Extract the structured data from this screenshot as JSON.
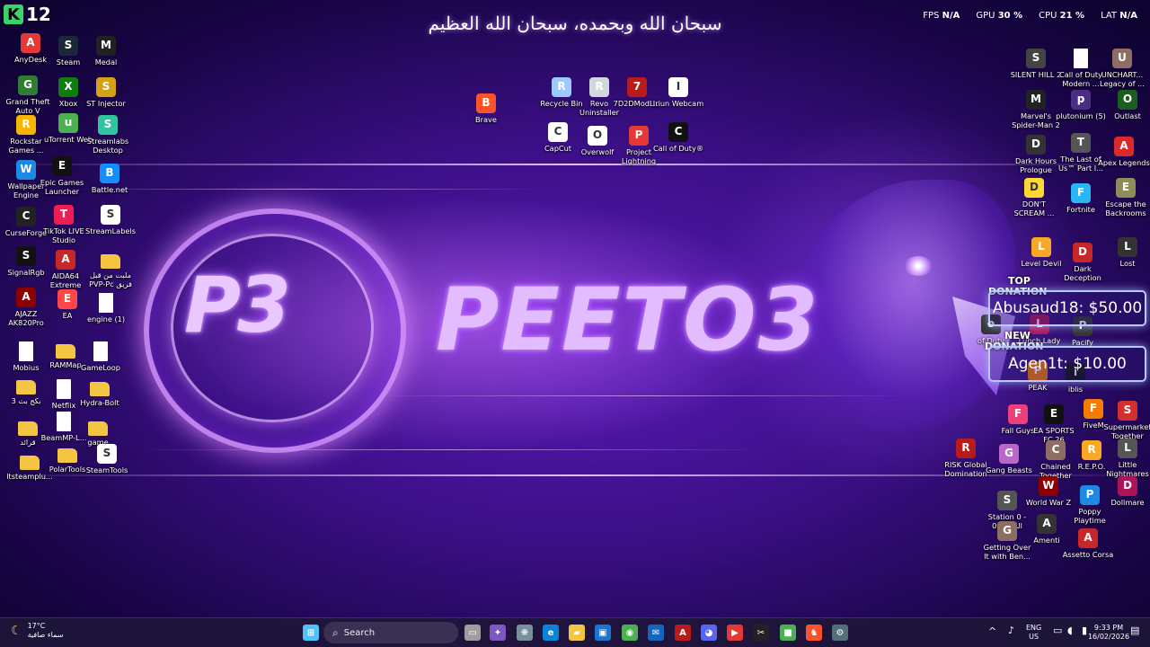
{
  "header": {
    "top_title": "سبحان الله وبحمده، سبحان الله العظيم",
    "k12_badge": "K",
    "k12_label": "12"
  },
  "perf": {
    "fps_label": "FPS",
    "fps_value": "N/A",
    "gpu_label": "GPU",
    "gpu_value": "30 %",
    "cpu_label": "CPU",
    "cpu_value": "21 %",
    "lat_label": "LAT",
    "lat_value": "N/A"
  },
  "wallpaper": {
    "logo_text": "P3",
    "brand_name": "PEETO3"
  },
  "donations": {
    "top_tag_1": "TOP",
    "top_tag_2": "DONATION",
    "top_text": "Abusaud18: $50.00",
    "new_tag_1": "NEW",
    "new_tag_2": "DONATION",
    "new_text": "Agen1t: $10.00"
  },
  "desktop_icons": [
    {
      "label": "AnyDesk",
      "icon": "anydesk-icon",
      "color": "#e53935"
    },
    {
      "label": "Steam",
      "icon": "steam-icon",
      "color": "#1b2838"
    },
    {
      "label": "Medal",
      "icon": "medal-icon",
      "color": "#222222"
    },
    {
      "label": "Grand Theft Auto V",
      "icon": "gta-icon",
      "color": "#2e7d32"
    },
    {
      "label": "Xbox",
      "icon": "xbox-icon",
      "color": "#107c10"
    },
    {
      "label": "ST Injector",
      "icon": "injector-icon",
      "color": "#d4a017"
    },
    {
      "label": "Rockstar Games ...",
      "icon": "rockstar-icon",
      "color": "#f7b500"
    },
    {
      "label": "uTorrent Web",
      "icon": "utorrent-icon",
      "color": "#4caf50"
    },
    {
      "label": "Streamlabs Desktop",
      "icon": "streamlabs-icon",
      "color": "#31c3a2"
    },
    {
      "label": "Wallpaper Engine",
      "icon": "wallpaper-engine-icon",
      "color": "#1e88e5"
    },
    {
      "label": "Epic Games Launcher",
      "icon": "epic-games-icon",
      "color": "#111111"
    },
    {
      "label": "Battle.net",
      "icon": "battlenet-icon",
      "color": "#148eff"
    },
    {
      "label": "CurseForge",
      "icon": "curseforge-icon",
      "color": "#222222"
    },
    {
      "label": "TikTok LIVE Studio",
      "icon": "tiktok-icon",
      "color": "#ee1d52"
    },
    {
      "label": "StreamLabels",
      "icon": "streamlabels-icon",
      "color": "#ffffff"
    },
    {
      "label": "SignalRgb",
      "icon": "signalrgb-icon",
      "color": "#111111"
    },
    {
      "label": "AIDA64 Extreme",
      "icon": "aida64-icon",
      "color": "#c62828"
    },
    {
      "label": "ملبت من قبل PVP-Pc فريق",
      "icon": "folder-icon",
      "color": "#f4c542"
    },
    {
      "label": "AJAZZ AK820Pro",
      "icon": "ajazz-icon",
      "color": "#8b0000"
    },
    {
      "label": "EA",
      "icon": "ea-icon",
      "color": "#ff4747"
    },
    {
      "label": "engine (1)",
      "icon": "file-icon",
      "color": "#ffffff"
    },
    {
      "label": "Mobius",
      "icon": "file-icon",
      "color": "#ffffff"
    },
    {
      "label": "RAMMap",
      "icon": "folder-icon",
      "color": "#f4c542"
    },
    {
      "label": "GameLoop",
      "icon": "file-icon",
      "color": "#ffffff"
    },
    {
      "label": "بكج بث 3",
      "icon": "folder-icon",
      "color": "#f4c542"
    },
    {
      "label": "Netflix",
      "icon": "file-icon",
      "color": "#ffffff"
    },
    {
      "label": "Hydra-Bolt",
      "icon": "folder-icon",
      "color": "#f4c542"
    },
    {
      "label": "قرائد",
      "icon": "folder-icon",
      "color": "#f4c542"
    },
    {
      "label": "BeamMP-L...",
      "icon": "file-icon",
      "color": "#ffffff"
    },
    {
      "label": "game",
      "icon": "folder-icon",
      "color": "#f4c542"
    },
    {
      "label": "ltsteamplu...",
      "icon": "folder-icon",
      "color": "#f4c542"
    },
    {
      "label": "PolarTools",
      "icon": "folder-icon",
      "color": "#f4c542"
    },
    {
      "label": "SteamTools",
      "icon": "steamtools-icon",
      "color": "#ffffff"
    },
    {
      "label": "Brave",
      "icon": "brave-icon",
      "color": "#fb542b"
    },
    {
      "label": "Recycle Bin",
      "icon": "recycle-bin-icon",
      "color": "#9ec9ff"
    },
    {
      "label": "Revo Uninstaller",
      "icon": "revo-icon",
      "color": "#cfd8dc"
    },
    {
      "label": "7D2DModL...",
      "icon": "mod-icon",
      "color": "#b71c1c"
    },
    {
      "label": "Iriun Webcam",
      "icon": "webcam-icon",
      "color": "#ffffff"
    },
    {
      "label": "CapCut",
      "icon": "capcut-icon",
      "color": "#ffffff"
    },
    {
      "label": "Overwolf",
      "icon": "overwolf-icon",
      "color": "#ffffff"
    },
    {
      "label": "Project Lightning",
      "icon": "lightning-icon",
      "color": "#e53935"
    },
    {
      "label": "Call of Duty®",
      "icon": "cod-icon",
      "color": "#111111"
    },
    {
      "label": "SILENT HILL 2",
      "icon": "silent-hill-icon",
      "color": "#444444"
    },
    {
      "label": "Call of Duty Modern ...",
      "icon": "file-icon",
      "color": "#ffffff"
    },
    {
      "label": "UNCHART... Legacy of ...",
      "icon": "uncharted-icon",
      "color": "#8d6e63"
    },
    {
      "label": "Marvel's Spider-Man 2",
      "icon": "spiderman-icon",
      "color": "#222222"
    },
    {
      "label": "plutonium (5)",
      "icon": "plutonium-icon",
      "color": "#4b2e83"
    },
    {
      "label": "Outlast",
      "icon": "outlast-icon",
      "color": "#1b5e20"
    },
    {
      "label": "Dark Hours Prologue",
      "icon": "dark-hours-icon",
      "color": "#333333"
    },
    {
      "label": "The Last of Us™ Part I...",
      "icon": "tlou-icon",
      "color": "#555555"
    },
    {
      "label": "Apex Legends",
      "icon": "apex-icon",
      "color": "#da292a"
    },
    {
      "label": "DON'T SCREAM ...",
      "icon": "dont-scream-icon",
      "color": "#fdd835"
    },
    {
      "label": "Fortnite",
      "icon": "fortnite-icon",
      "color": "#29b6f6"
    },
    {
      "label": "Escape the Backrooms",
      "icon": "backrooms-icon",
      "color": "#8d8d5a"
    },
    {
      "label": "Level Devil",
      "icon": "level-devil-icon",
      "color": "#f9a825"
    },
    {
      "label": "Dark Deception",
      "icon": "dark-deception-icon",
      "color": "#c62828"
    },
    {
      "label": "Lost",
      "icon": "lost-icon",
      "color": "#333333"
    },
    {
      "label": "of Duty",
      "icon": "cod2-icon",
      "color": "#333333"
    },
    {
      "label": "Lunch Lady",
      "icon": "lunch-lady-icon",
      "color": "#ad1457"
    },
    {
      "label": "Pacify",
      "icon": "pacify-icon",
      "color": "#333333"
    },
    {
      "label": "PEAK",
      "icon": "peak-icon",
      "color": "#f57c00"
    },
    {
      "label": "iblis",
      "icon": "iblis-icon",
      "color": "#111111"
    },
    {
      "label": "Fall Guys",
      "icon": "fall-guys-icon",
      "color": "#ec407a"
    },
    {
      "label": "EA SPORTS FC 26",
      "icon": "fc26-icon",
      "color": "#111111"
    },
    {
      "label": "FiveM",
      "icon": "fivem-icon",
      "color": "#f57c00"
    },
    {
      "label": "Supermarket Together",
      "icon": "supermarket-icon",
      "color": "#d32f2f"
    },
    {
      "label": "RISK Global Domination",
      "icon": "risk-icon",
      "color": "#b71c1c"
    },
    {
      "label": "Gang Beasts",
      "icon": "gang-beasts-icon",
      "color": "#ba68c8"
    },
    {
      "label": "Chained Together",
      "icon": "chained-icon",
      "color": "#8d6e63"
    },
    {
      "label": "R.E.P.O.",
      "icon": "repo-icon",
      "color": "#f9a825"
    },
    {
      "label": "Little Nightmares",
      "icon": "little-nightmares-icon",
      "color": "#555555"
    },
    {
      "label": "World War Z",
      "icon": "wwz-icon",
      "color": "#8b0000"
    },
    {
      "label": "Poppy Playtime",
      "icon": "poppy-icon",
      "color": "#1e88e5"
    },
    {
      "label": "Dollmare",
      "icon": "dollmare-icon",
      "color": "#ad1457"
    },
    {
      "label": "Station 0 - المحطة 0",
      "icon": "station-icon",
      "color": "#555555"
    },
    {
      "label": "Getting Over It with Ben...",
      "icon": "getting-over-it-icon",
      "color": "#8d6e63"
    },
    {
      "label": "Amenti",
      "icon": "amenti-icon",
      "color": "#333333"
    },
    {
      "label": "Assetto Corsa",
      "icon": "assetto-icon",
      "color": "#c62828"
    }
  ],
  "taskbar": {
    "weather_temp": "17°C",
    "weather_desc": "سماء صافية",
    "search_placeholder": "Search",
    "lang_1": "ENG",
    "lang_2": "US",
    "time": "9:33 PM",
    "date": "16/02/2026",
    "apps": [
      {
        "icon": "start-icon",
        "color": "#4fc3f7",
        "glyph": "⊞"
      },
      {
        "icon": "task-view-icon",
        "color": "#9e9e9e",
        "glyph": "▭"
      },
      {
        "icon": "copilot-icon",
        "color": "#7e57c2",
        "glyph": "✦"
      },
      {
        "icon": "widgets-icon",
        "color": "#78909c",
        "glyph": "❋"
      },
      {
        "icon": "edge-icon",
        "color": "#0a84d6",
        "glyph": "e"
      },
      {
        "icon": "file-explorer-icon",
        "color": "#f4c542",
        "glyph": "▰"
      },
      {
        "icon": "store-icon",
        "color": "#1976d2",
        "glyph": "▣"
      },
      {
        "icon": "chrome-icon",
        "color": "#4caf50",
        "glyph": "◉"
      },
      {
        "icon": "outlook-icon",
        "color": "#1565c0",
        "glyph": "✉"
      },
      {
        "icon": "acrobat-icon",
        "color": "#b71c1c",
        "glyph": "A"
      },
      {
        "icon": "discord-icon",
        "color": "#5865f2",
        "glyph": "◕"
      },
      {
        "icon": "video-editor-icon",
        "color": "#e53935",
        "glyph": "▶"
      },
      {
        "icon": "capcut-taskbar-icon",
        "color": "#222222",
        "glyph": "✂"
      },
      {
        "icon": "minecraft-icon",
        "color": "#4caf50",
        "glyph": "■"
      },
      {
        "icon": "brave-taskbar-icon",
        "color": "#fb542b",
        "glyph": "♞"
      },
      {
        "icon": "steam-taskbar-icon",
        "color": "#546e7a",
        "glyph": "⚙"
      }
    ]
  }
}
